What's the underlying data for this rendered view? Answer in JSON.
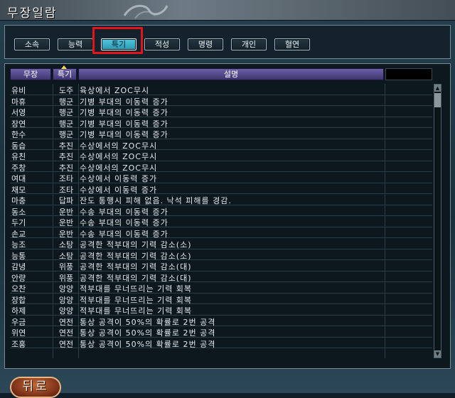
{
  "window": {
    "title": "무장일람"
  },
  "tabs": [
    {
      "label": "소속"
    },
    {
      "label": "능력"
    },
    {
      "label": "특기"
    },
    {
      "label": "적성"
    },
    {
      "label": "명령"
    },
    {
      "label": "개인"
    },
    {
      "label": "혈연"
    }
  ],
  "active_tab": "특기",
  "table": {
    "columns": [
      "무장",
      "특기",
      "설명",
      ""
    ],
    "rows": [
      {
        "name": "유비",
        "skill": "도주",
        "desc": "육상에서 ZOC무시"
      },
      {
        "name": "마휴",
        "skill": "행군",
        "desc": "기병 부대의 이동력 증가"
      },
      {
        "name": "서영",
        "skill": "행군",
        "desc": "기병 부대의 이동력 증가"
      },
      {
        "name": "장연",
        "skill": "행군",
        "desc": "기병 부대의 이동력 증가"
      },
      {
        "name": "한수",
        "skill": "행군",
        "desc": "기병 부대의 이동력 증가"
      },
      {
        "name": "동습",
        "skill": "추진",
        "desc": "수상에서의 ZOC무시"
      },
      {
        "name": "유친",
        "skill": "추진",
        "desc": "수상에서의 ZOC무시"
      },
      {
        "name": "주창",
        "skill": "추진",
        "desc": "수상에서의 ZOC무시"
      },
      {
        "name": "여대",
        "skill": "조타",
        "desc": "수상에서 이동력 증가"
      },
      {
        "name": "채모",
        "skill": "조타",
        "desc": "수상에서 이동력 증가"
      },
      {
        "name": "마충",
        "skill": "답파",
        "desc": "잔도 통행시 피해 없음. 낙석 피해를 경감."
      },
      {
        "name": "동소",
        "skill": "운반",
        "desc": "수송 부대의 이동력 증가"
      },
      {
        "name": "두기",
        "skill": "운반",
        "desc": "수송 부대의 이동력 증가"
      },
      {
        "name": "손교",
        "skill": "운반",
        "desc": "수송 부대의 이동력 증가"
      },
      {
        "name": "능조",
        "skill": "소탕",
        "desc": "공격한 적부대의 기력 감소(소)"
      },
      {
        "name": "능통",
        "skill": "소탕",
        "desc": "공격한 적부대의 기력 감소(소)"
      },
      {
        "name": "감녕",
        "skill": "위풍",
        "desc": "공격한 적부대의 기력 감소(대)"
      },
      {
        "name": "안량",
        "skill": "위풍",
        "desc": "공격한 적부대의 기력 감소(대)"
      },
      {
        "name": "오찬",
        "skill": "앙양",
        "desc": "적부대를 무너뜨리는 기력 회복"
      },
      {
        "name": "장합",
        "skill": "앙양",
        "desc": "적부대를 무너뜨리는 기력 회복"
      },
      {
        "name": "하제",
        "skill": "앙양",
        "desc": "적부대를 무너뜨리는 기력 회복"
      },
      {
        "name": "우금",
        "skill": "연전",
        "desc": "통상 공격이 50%의 확률로 2번 공격"
      },
      {
        "name": "위연",
        "skill": "연전",
        "desc": "통상 공격이 50%의 확률로 2번 공격"
      },
      {
        "name": "조홍",
        "skill": "연전",
        "desc": "통상 공격이 50%의 확률로 2번 공격"
      }
    ]
  },
  "footer": {
    "back_label": "뒤로"
  },
  "colors": {
    "active_tab": "#3fb6cc",
    "highlight_box": "#e3141c",
    "header_purple": "#5a4f93",
    "back_button": "#8a3a1e"
  },
  "icons": [
    "sort-indicator-icon",
    "scroll-up-icon",
    "scroll-down-icon",
    "cloud-swirl-icon"
  ]
}
